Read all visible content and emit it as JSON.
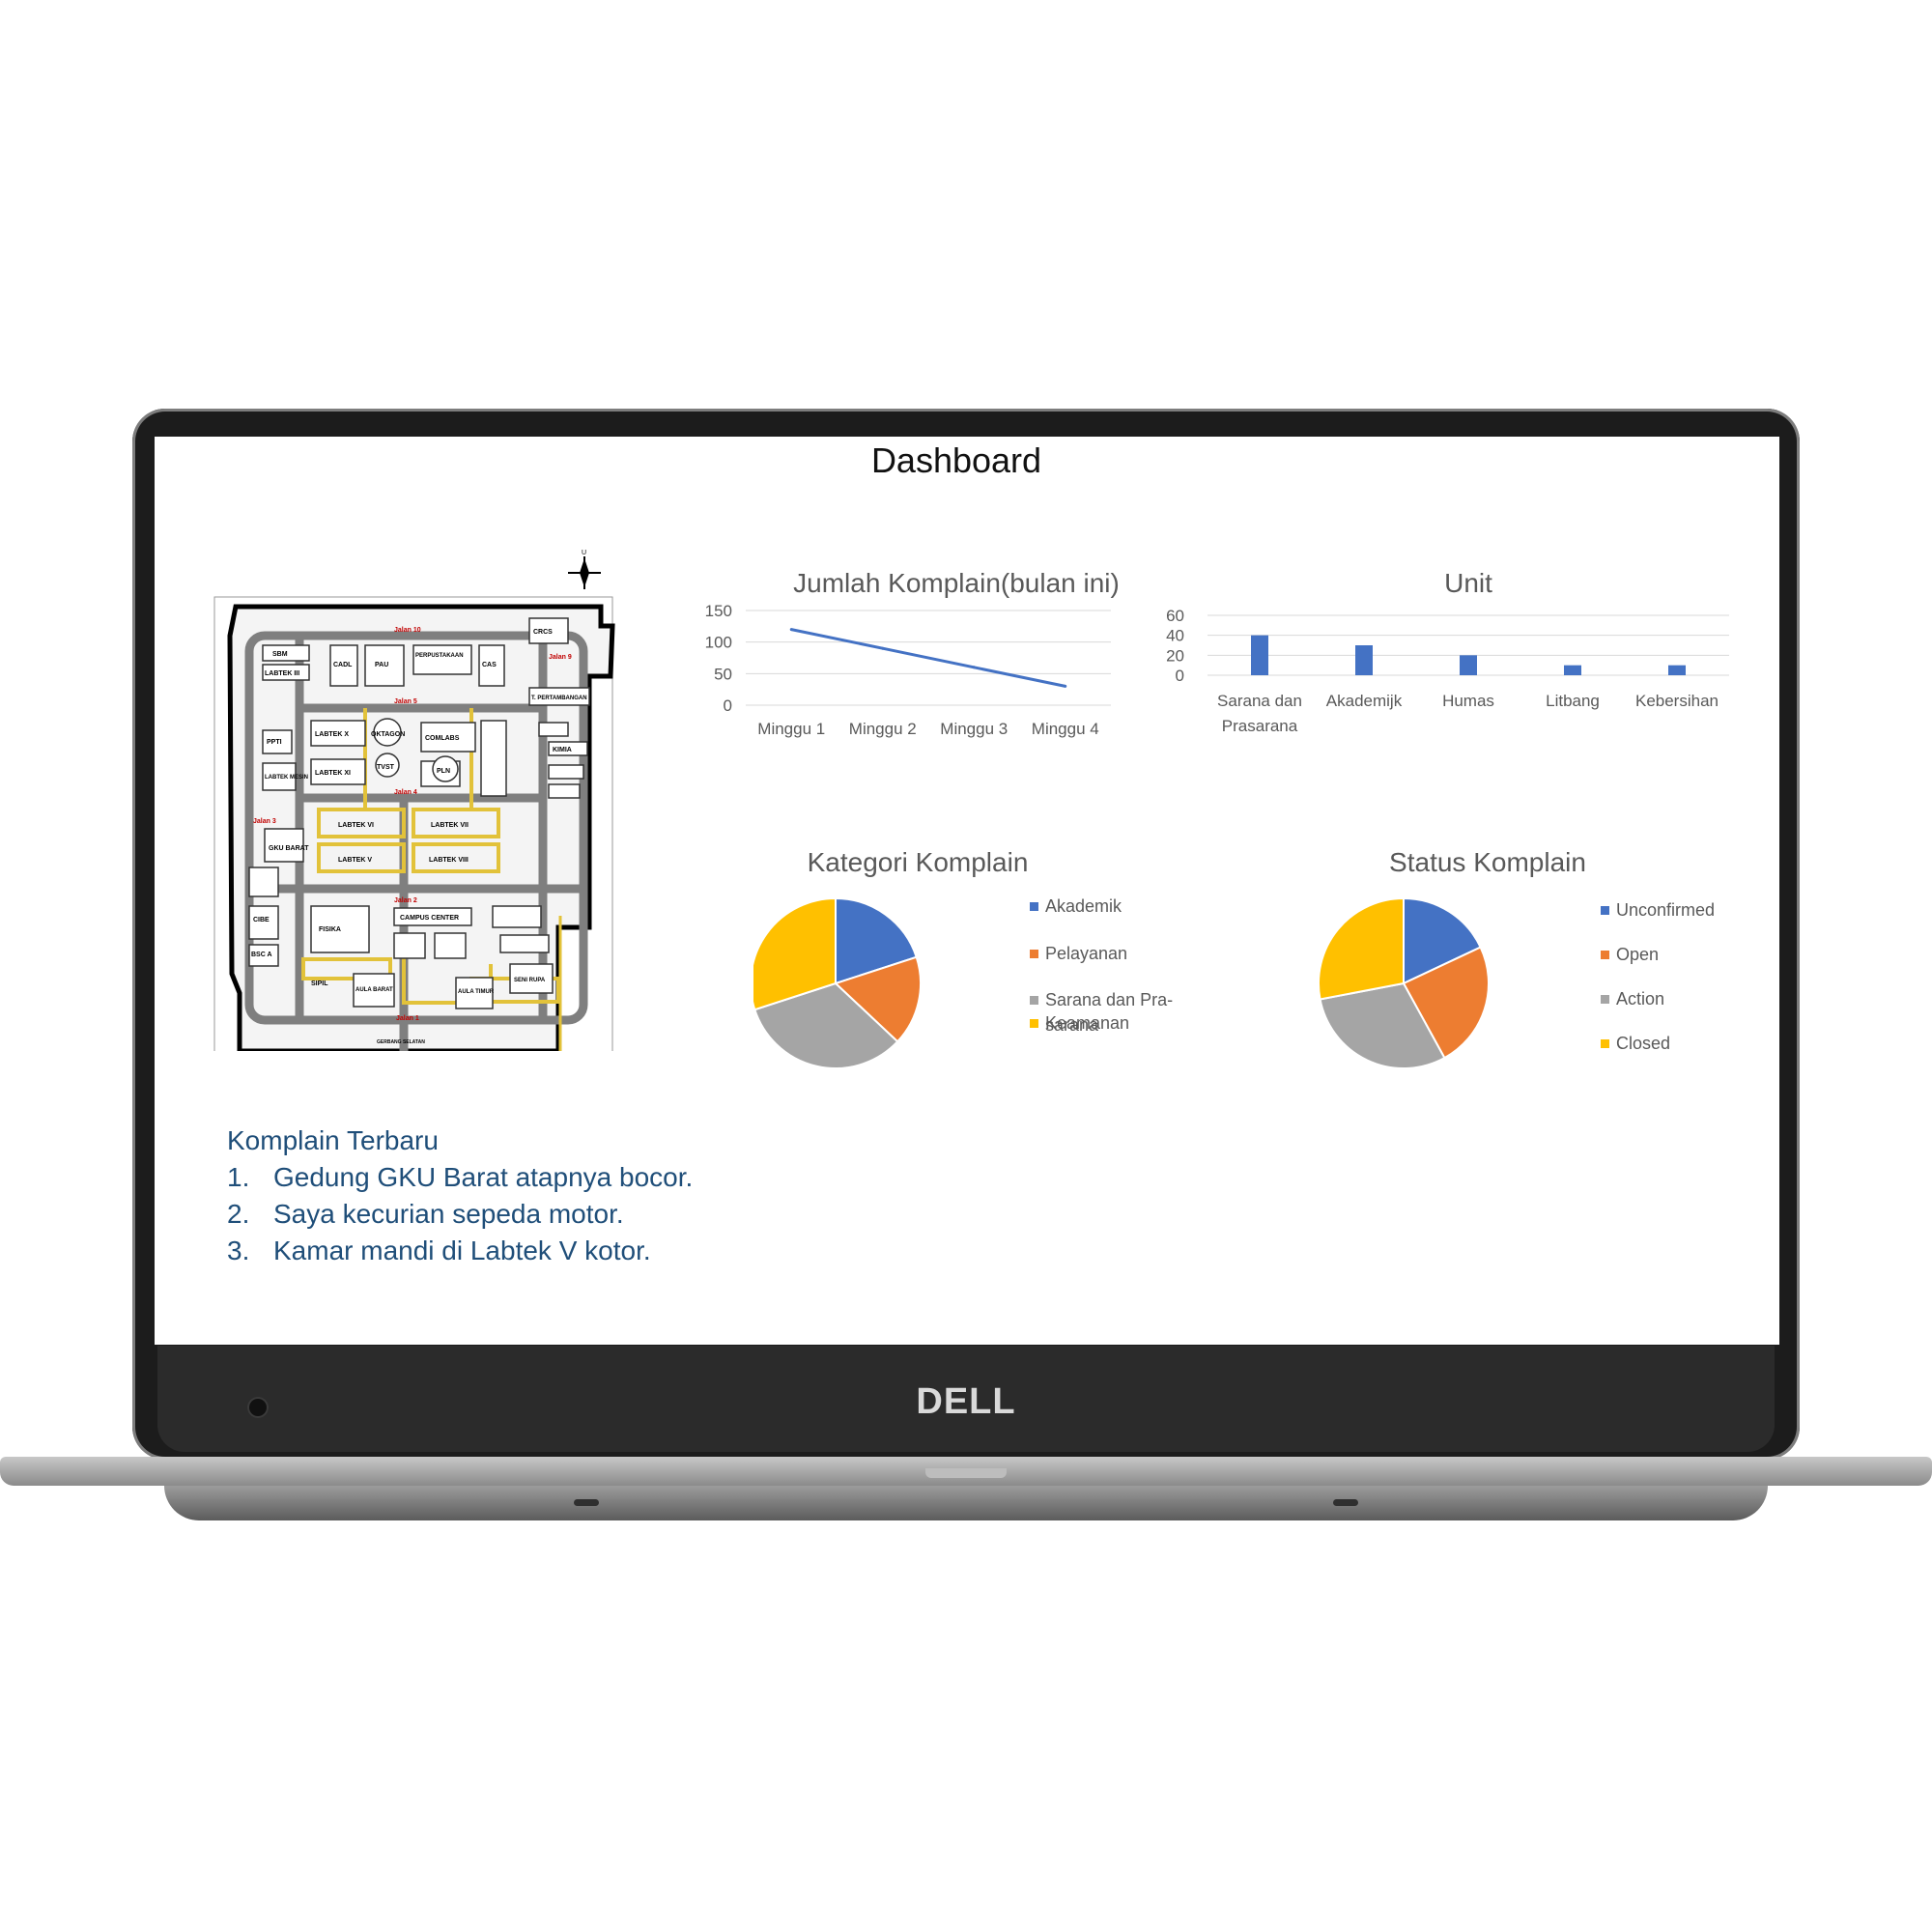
{
  "screen": {
    "title": "Dashboard"
  },
  "device": {
    "brand": "DELL"
  },
  "map": {
    "labels": [
      "CRCS",
      "SBM",
      "LABTEK III",
      "CADL",
      "PAU",
      "PERPUSTAKAAN",
      "CAS",
      "Jalan 10",
      "Jalan 9",
      "Jalan 5",
      "T. PERTAMBANGAN",
      "LABTEK X",
      "OKTAGON",
      "COMLABS",
      "PPTI",
      "TVST",
      "PLN",
      "LABTEK XI",
      "LABTEK MESIN",
      "KIMIA",
      "Jalan 4",
      "LABTEK VI",
      "LABTEK VII",
      "LABTEK V",
      "LABTEK VIII",
      "GKU BARAT",
      "Jalan 3",
      "CIBE",
      "FISIKA",
      "BSC A",
      "CAMPUS CENTER",
      "Jalan 2",
      "SIPIL",
      "AULA BARAT",
      "AULA TIMUR",
      "SENI RUPA",
      "Jalan 1",
      "GERBANG SELATAN"
    ],
    "compass": "U"
  },
  "chart_data": [
    {
      "type": "line",
      "title": "Jumlah Komplain(bulan ini)",
      "categories": [
        "Minggu 1",
        "Minggu 2",
        "Minggu 3",
        "Minggu 4"
      ],
      "series": [
        {
          "values": [
            120,
            90,
            60,
            30
          ]
        }
      ],
      "yticks": [
        "150",
        "100",
        "50",
        "0"
      ],
      "ylim": [
        0,
        150
      ],
      "color": "#4472c4",
      "grid": true
    },
    {
      "type": "bar",
      "title": "Unit",
      "categories": [
        [
          "Sarana dan",
          "Prasarana"
        ],
        [
          "Akademijk"
        ],
        [
          "Humas"
        ],
        [
          "Litbang"
        ],
        [
          "Kebersihan"
        ]
      ],
      "values": [
        40,
        30,
        20,
        10,
        10
      ],
      "yticks": [
        "60",
        "40",
        "20",
        "0"
      ],
      "ylim": [
        0,
        60
      ],
      "color": "#4472c4",
      "grid": true
    },
    {
      "type": "pie",
      "title": "Kategori Komplain",
      "labels": [
        [
          "Akademik"
        ],
        [
          "Pelayanan"
        ],
        [
          "Sarana dan Pra-",
          "sarana"
        ],
        [
          "Keamanan"
        ]
      ],
      "values": [
        20,
        17,
        33,
        30
      ],
      "colors": [
        "#4472c4",
        "#ed7d31",
        "#a5a5a5",
        "#ffc000"
      ],
      "legend": "right"
    },
    {
      "type": "pie",
      "title": "Status Komplain",
      "labels": [
        [
          "Unconfirmed"
        ],
        [
          "Open"
        ],
        [
          "Action"
        ],
        [
          "Closed"
        ]
      ],
      "values": [
        18,
        24,
        30,
        28
      ],
      "colors": [
        "#4472c4",
        "#ed7d31",
        "#a5a5a5",
        "#ffc000"
      ],
      "legend": "right"
    }
  ],
  "complaints": {
    "heading": "Komplain Terbaru",
    "items": [
      {
        "num": "1.",
        "text": "Gedung GKU Barat atapnya bocor."
      },
      {
        "num": "2.",
        "text": "Saya kecurian sepeda motor."
      },
      {
        "num": "3.",
        "text": "Kamar mandi di Labtek V kotor."
      }
    ]
  }
}
